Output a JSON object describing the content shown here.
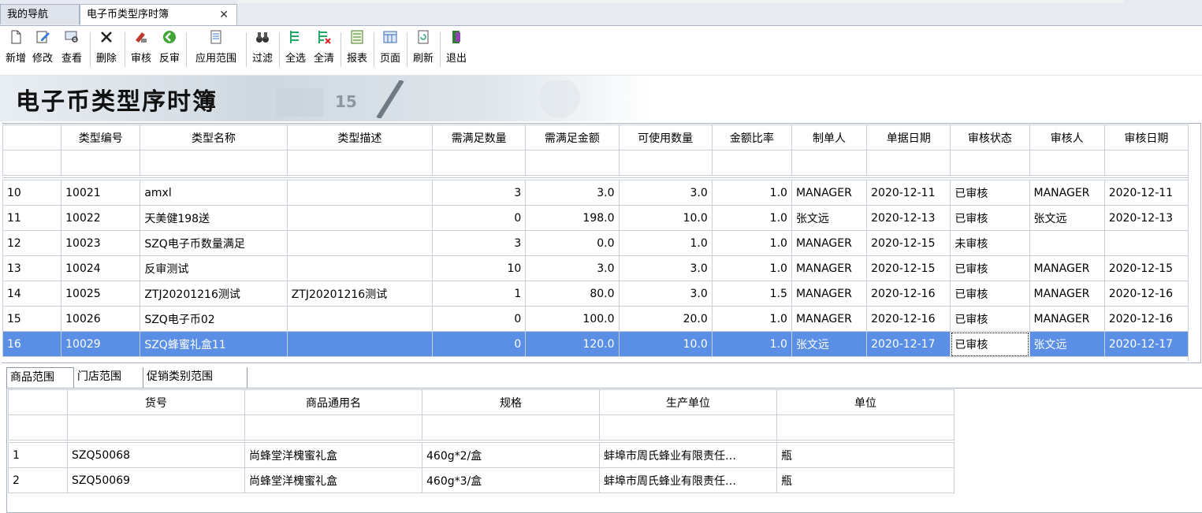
{
  "tabs": [
    {
      "label": "我的导航"
    },
    {
      "label": "电子币类型序时簿",
      "close": "✕"
    }
  ],
  "toolbar": [
    {
      "label": "新增",
      "icon": "new-icon"
    },
    {
      "label": "修改",
      "icon": "edit-icon"
    },
    {
      "label": "查看",
      "icon": "view-icon"
    },
    {
      "label": "删除",
      "icon": "delete-icon"
    },
    {
      "label": "审核",
      "icon": "audit-icon"
    },
    {
      "label": "反审",
      "icon": "unaudit-icon"
    },
    {
      "label": "应用范围",
      "icon": "scope-icon"
    },
    {
      "label": "过滤",
      "icon": "filter-icon"
    },
    {
      "label": "全选",
      "icon": "select-all-icon"
    },
    {
      "label": "全清",
      "icon": "clear-all-icon"
    },
    {
      "label": "报表",
      "icon": "report-icon"
    },
    {
      "label": "页面",
      "icon": "page-icon"
    },
    {
      "label": "刷新",
      "icon": "refresh-icon"
    },
    {
      "label": "退出",
      "icon": "exit-icon"
    }
  ],
  "banner": {
    "title": "电子币类型序时簿"
  },
  "main_grid": {
    "columns": [
      "",
      "类型编号",
      "类型名称",
      "类型描述",
      "需满足数量",
      "需满足金额",
      "可使用数量",
      "金额比率",
      "制单人",
      "单据日期",
      "审核状态",
      "审核人",
      "审核日期"
    ],
    "rows": [
      [
        "10",
        "10021",
        "amxl",
        "",
        "3",
        "3.0",
        "3.0",
        "1.0",
        "MANAGER",
        "2020-12-11",
        "已审核",
        "MANAGER",
        "2020-12-11"
      ],
      [
        "11",
        "10022",
        "天美健198送",
        "",
        "0",
        "198.0",
        "10.0",
        "1.0",
        "张文远",
        "2020-12-13",
        "已审核",
        "张文远",
        "2020-12-13"
      ],
      [
        "12",
        "10023",
        "SZQ电子币数量满足",
        "",
        "3",
        "0.0",
        "1.0",
        "1.0",
        "MANAGER",
        "2020-12-15",
        "未审核",
        "",
        ""
      ],
      [
        "13",
        "10024",
        "反审测试",
        "",
        "10",
        "3.0",
        "3.0",
        "1.0",
        "MANAGER",
        "2020-12-15",
        "已审核",
        "MANAGER",
        "2020-12-15"
      ],
      [
        "14",
        "10025",
        "ZTJ20201216测试",
        "ZTJ20201216测试",
        "1",
        "80.0",
        "3.0",
        "1.5",
        "MANAGER",
        "2020-12-16",
        "已审核",
        "MANAGER",
        "2020-12-16"
      ],
      [
        "15",
        "10026",
        "SZQ电子币02",
        "",
        "0",
        "100.0",
        "20.0",
        "1.0",
        "MANAGER",
        "2020-12-16",
        "已审核",
        "MANAGER",
        "2020-12-16"
      ],
      [
        "16",
        "10029",
        "SZQ蜂蜜礼盒11",
        "",
        "0",
        "120.0",
        "10.0",
        "1.0",
        "张文远",
        "2020-12-17",
        "已审核",
        "张文远",
        "2020-12-17"
      ]
    ],
    "selected_row": "16"
  },
  "sub_tabs": [
    {
      "label": "商品范围"
    },
    {
      "label": "门店范围"
    },
    {
      "label": "促销类别范围"
    }
  ],
  "sub_grid": {
    "columns": [
      "",
      "货号",
      "商品通用名",
      "规格",
      "生产单位",
      "单位"
    ],
    "rows": [
      [
        "1",
        "SZQ50068",
        "尚蜂堂洋槐蜜礼盒",
        "460g*2/盒",
        "蚌埠市周氏蜂业有限责任…",
        "瓶"
      ],
      [
        "2",
        "SZQ50069",
        "尚蜂堂洋槐蜜礼盒",
        "460g*3/盒",
        "蚌埠市周氏蜂业有限责任…",
        "瓶"
      ]
    ]
  },
  "colors": {
    "selection": "#5b8fe6",
    "grid_line": "#c9cfd8",
    "tab_bg": "#e8ecf2"
  }
}
